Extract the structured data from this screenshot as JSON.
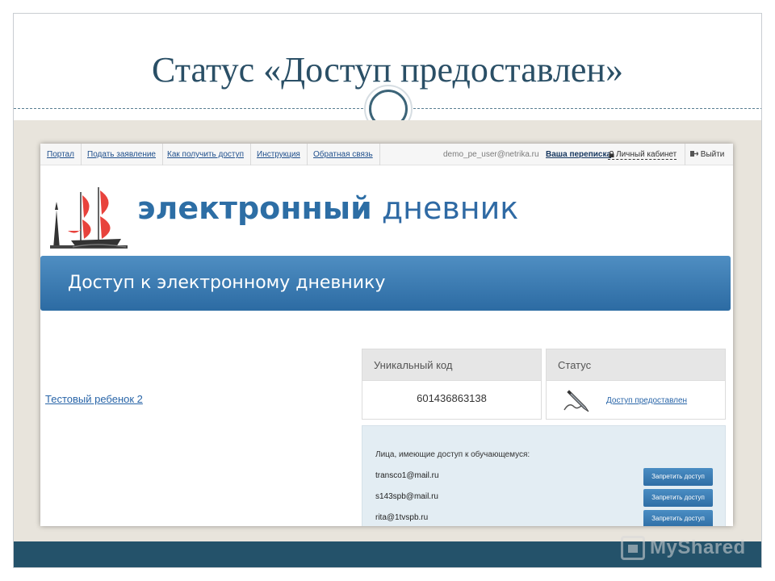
{
  "slide": {
    "title": "Статус «Доступ предоставлен»",
    "watermark": "MyShared"
  },
  "topnav": {
    "links": [
      "Портал",
      "Подать заявление",
      "Как получить доступ",
      "Инструкция",
      "Обратная связь"
    ],
    "user_email": "demo_pe_user@netrika.ru",
    "mail_link": "Ваша переписка",
    "cabinet": "Личный кабинет",
    "logout": "Выйти"
  },
  "brand": {
    "part1": "электронный",
    "part2": "дневник"
  },
  "banner": {
    "title": "Доступ к электронному дневнику"
  },
  "student": {
    "name": "Тестовый ребенок 2"
  },
  "code_panel": {
    "header": "Уникальный код",
    "value": "601436863138"
  },
  "status_panel": {
    "header": "Статус",
    "status": "Доступ предоставлен"
  },
  "access": {
    "title": "Лица, имеющие доступ к обучающемуся:",
    "people": [
      {
        "email": "transco1@mail.ru",
        "button": "Запретить доступ"
      },
      {
        "email": "s143spb@mail.ru",
        "button": "Запретить доступ"
      },
      {
        "email": "rita@1tvspb.ru",
        "button": "Запретить доступ"
      }
    ]
  },
  "colors": {
    "title": "#2a4f66",
    "banner": "#3a7ab3",
    "footer": "#24526a",
    "link": "#2965a8",
    "ship_sail": "#e8423c"
  }
}
